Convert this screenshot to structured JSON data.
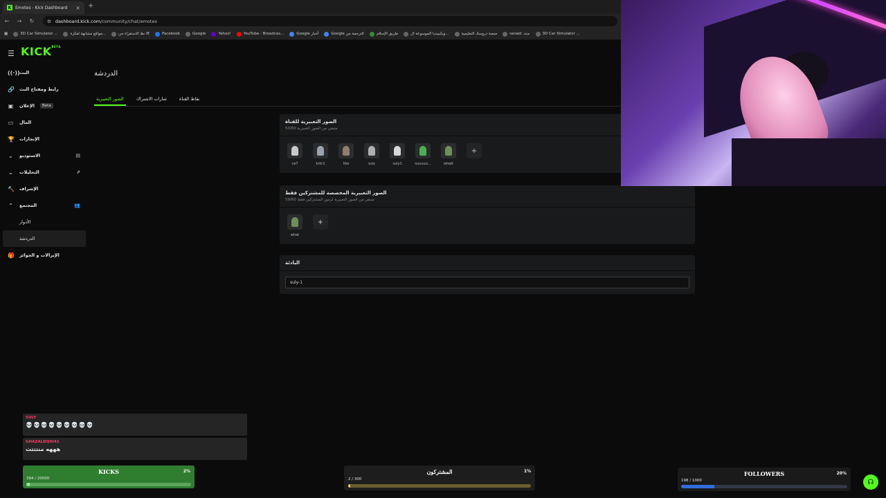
{
  "browser": {
    "tab_title": "Emotes - Kick Dashboard",
    "tab_close": "×",
    "new_tab": "+",
    "url_host": "dashboard.kick.com",
    "url_path": "/community/chat/emotes",
    "bookmarks": [
      "3D Car Simulator ...",
      "مواقع مشابهة لفكرة...",
      "نظ الاستفزاء من IE",
      "Facebook",
      "Google",
      "Yahoo!",
      "YouTube - Broadcas...",
      "Google أخبار",
      "Google الترجمة من",
      "طريق الإسلام",
      "ويكيبيديا الموسوعة ال...",
      "منصة دروسك التعليمية",
      "sanad: سند",
      "3D Car Simulator ..."
    ]
  },
  "app": {
    "logo": "KICK",
    "logo_badge": "BETA",
    "sidebar": {
      "stream": "البث",
      "stream_key": "رابط ومفتاح البث",
      "ads": "الإعلان",
      "ads_badge": "Beta",
      "wallet": "المال",
      "achievements": "الإنجازات",
      "studio": "الاستوديو",
      "analytics": "التحليلات",
      "moderation": "الإشراف",
      "community": "المجتمع",
      "roles": "الأدوار",
      "chat": "الدردشة",
      "drops": "الإنزالات و الجوائز"
    },
    "page_title": "الدردشة",
    "tabs": [
      "الصور التعبيرية",
      "شارات الاشتراك",
      "نقاط القناة"
    ],
    "channel_emotes": {
      "title": "الصور التعبيرية للقناة",
      "subtitle": "متبقي من الصور التعبيرية 53/60",
      "items": [
        "ca7",
        "krkr1",
        "like",
        "suly",
        "suly1",
        "suuuuu...",
        "whatt"
      ]
    },
    "sub_emotes": {
      "title": "الصور التعبيرية المخصصة للمشتركين فقط",
      "subtitle": "متبقي من الصور التعبيرية لرموز المشتركين فقط 59/60",
      "items": [
        "what"
      ]
    },
    "prefix": {
      "title": "البادئة",
      "value": "suly-1"
    },
    "add_symbol": "+"
  },
  "overlays": {
    "chat": [
      {
        "user": "SULY",
        "message": "💀💀💀💀💀💀💀💀💀"
      },
      {
        "user": "GHAZALDQHI41",
        "message": "هههه منتتتت"
      }
    ],
    "kicks": {
      "title": "KICKS",
      "percent": "2%",
      "count": "394 / 20000",
      "progress": 0.02
    },
    "subs": {
      "title": "المشتركون",
      "percent": "1%",
      "count": "2 / 300",
      "progress": 0.01
    },
    "followers": {
      "title": "FOLLOWERS",
      "percent": "20%",
      "count": "198 / 1000",
      "progress": 0.2
    }
  },
  "colors": {
    "brand": "#53fc18",
    "chat_user": "#ff3b6b",
    "followers_bar": "#2f6de0"
  }
}
